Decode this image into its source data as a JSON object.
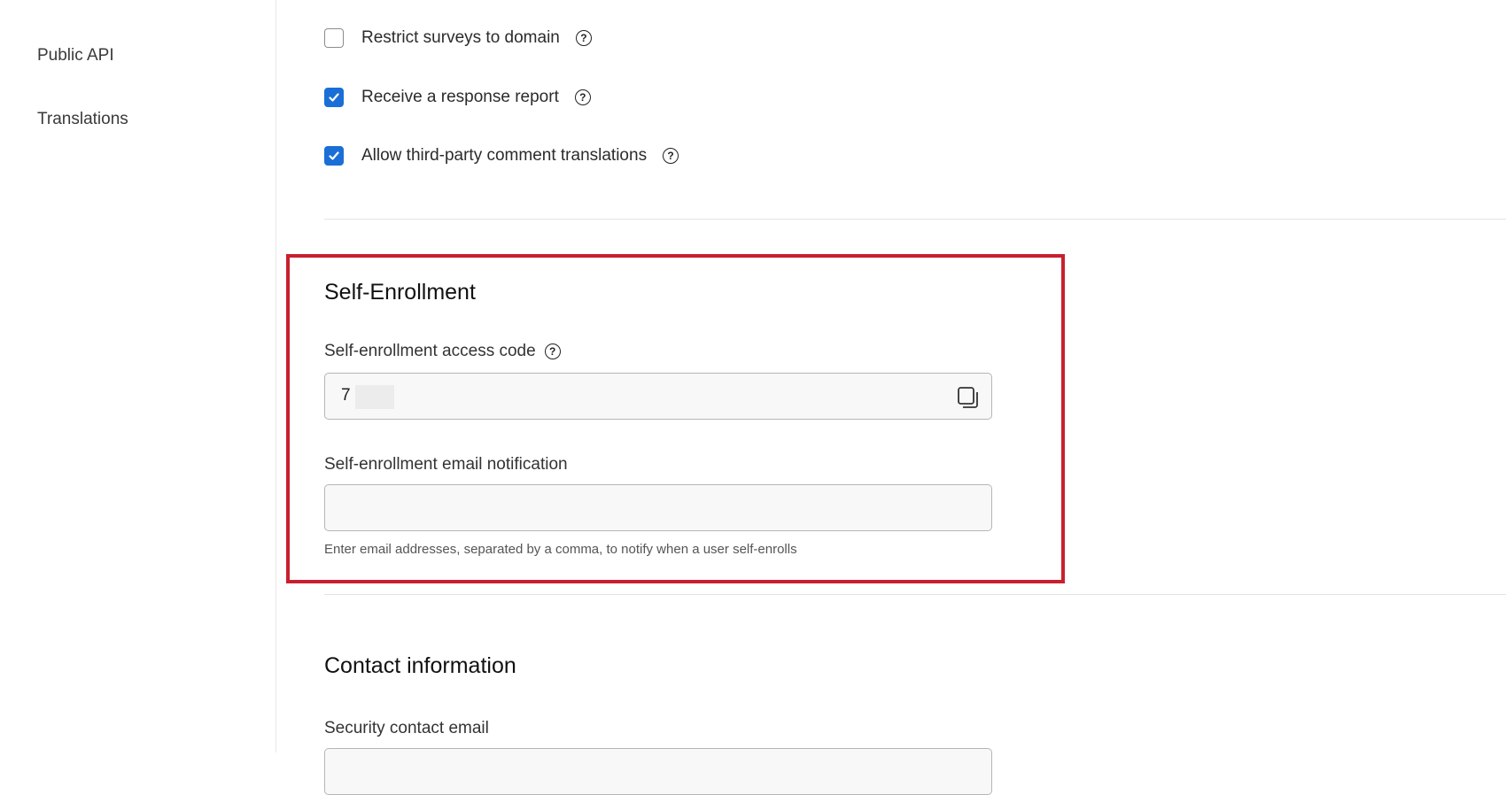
{
  "sidebar": {
    "items": [
      {
        "label": "Public API"
      },
      {
        "label": "Translations"
      }
    ]
  },
  "options": [
    {
      "label": "Restrict surveys to domain",
      "checked": false,
      "help_icon": "question-circle-icon"
    },
    {
      "label": "Receive a response report",
      "checked": true,
      "help_icon": "question-circle-icon"
    },
    {
      "label": "Allow third-party comment translations",
      "checked": true,
      "help_icon": "question-circle-icon"
    }
  ],
  "self_enrollment": {
    "title": "Self-Enrollment",
    "access_code_label": "Self-enrollment access code",
    "access_code_value": "7",
    "copy_icon": "copy-icon",
    "email_label": "Self-enrollment email notification",
    "email_value": "",
    "email_helper": "Enter email addresses, separated by a comma, to notify when a user self-enrolls"
  },
  "contact": {
    "title": "Contact information",
    "security_email_label": "Security contact email"
  },
  "colors": {
    "accent": "#1a6fd6",
    "highlight": "#c8202f"
  },
  "help_glyph": "?"
}
